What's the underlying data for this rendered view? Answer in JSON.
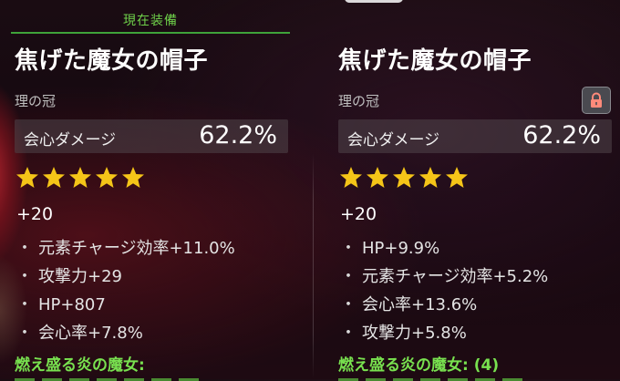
{
  "equipped": {
    "label": "現在装備"
  },
  "left": {
    "title": "焦げた魔女の帽子",
    "slot": "理の冠",
    "main_stat": {
      "name": "会心ダメージ",
      "value": "62.2%"
    },
    "rarity": 5,
    "level": "+20",
    "substats": [
      {
        "bullet": "・",
        "text": "元素チャージ効率+11.0%"
      },
      {
        "bullet": "・",
        "text": "攻撃力+29"
      },
      {
        "bullet": "・",
        "text": "HP+807"
      },
      {
        "bullet": "・",
        "text": "会心率+7.8%"
      }
    ],
    "set_name": "燃え盛る炎の魔女:"
  },
  "right": {
    "title": "焦げた魔女の帽子",
    "slot": "理の冠",
    "main_stat": {
      "name": "会心ダメージ",
      "value": "62.2%"
    },
    "rarity": 5,
    "level": "+20",
    "substats": [
      {
        "bullet": "・",
        "text": "HP+9.9%"
      },
      {
        "bullet": "・",
        "text": "元素チャージ効率+5.2%"
      },
      {
        "bullet": "・",
        "text": "会心率+13.6%"
      },
      {
        "bullet": "・",
        "text": "攻撃力+5.8%"
      }
    ],
    "set_name": "燃え盛る炎の魔女: (4)",
    "locked": true
  },
  "colors": {
    "star": "#f5c518",
    "set_green": "#78e14f",
    "equipped_green": "#6fd14a",
    "lock_icon": "#ff8a7a"
  },
  "icons": {
    "star": "star-icon",
    "lock": "lock-icon"
  }
}
